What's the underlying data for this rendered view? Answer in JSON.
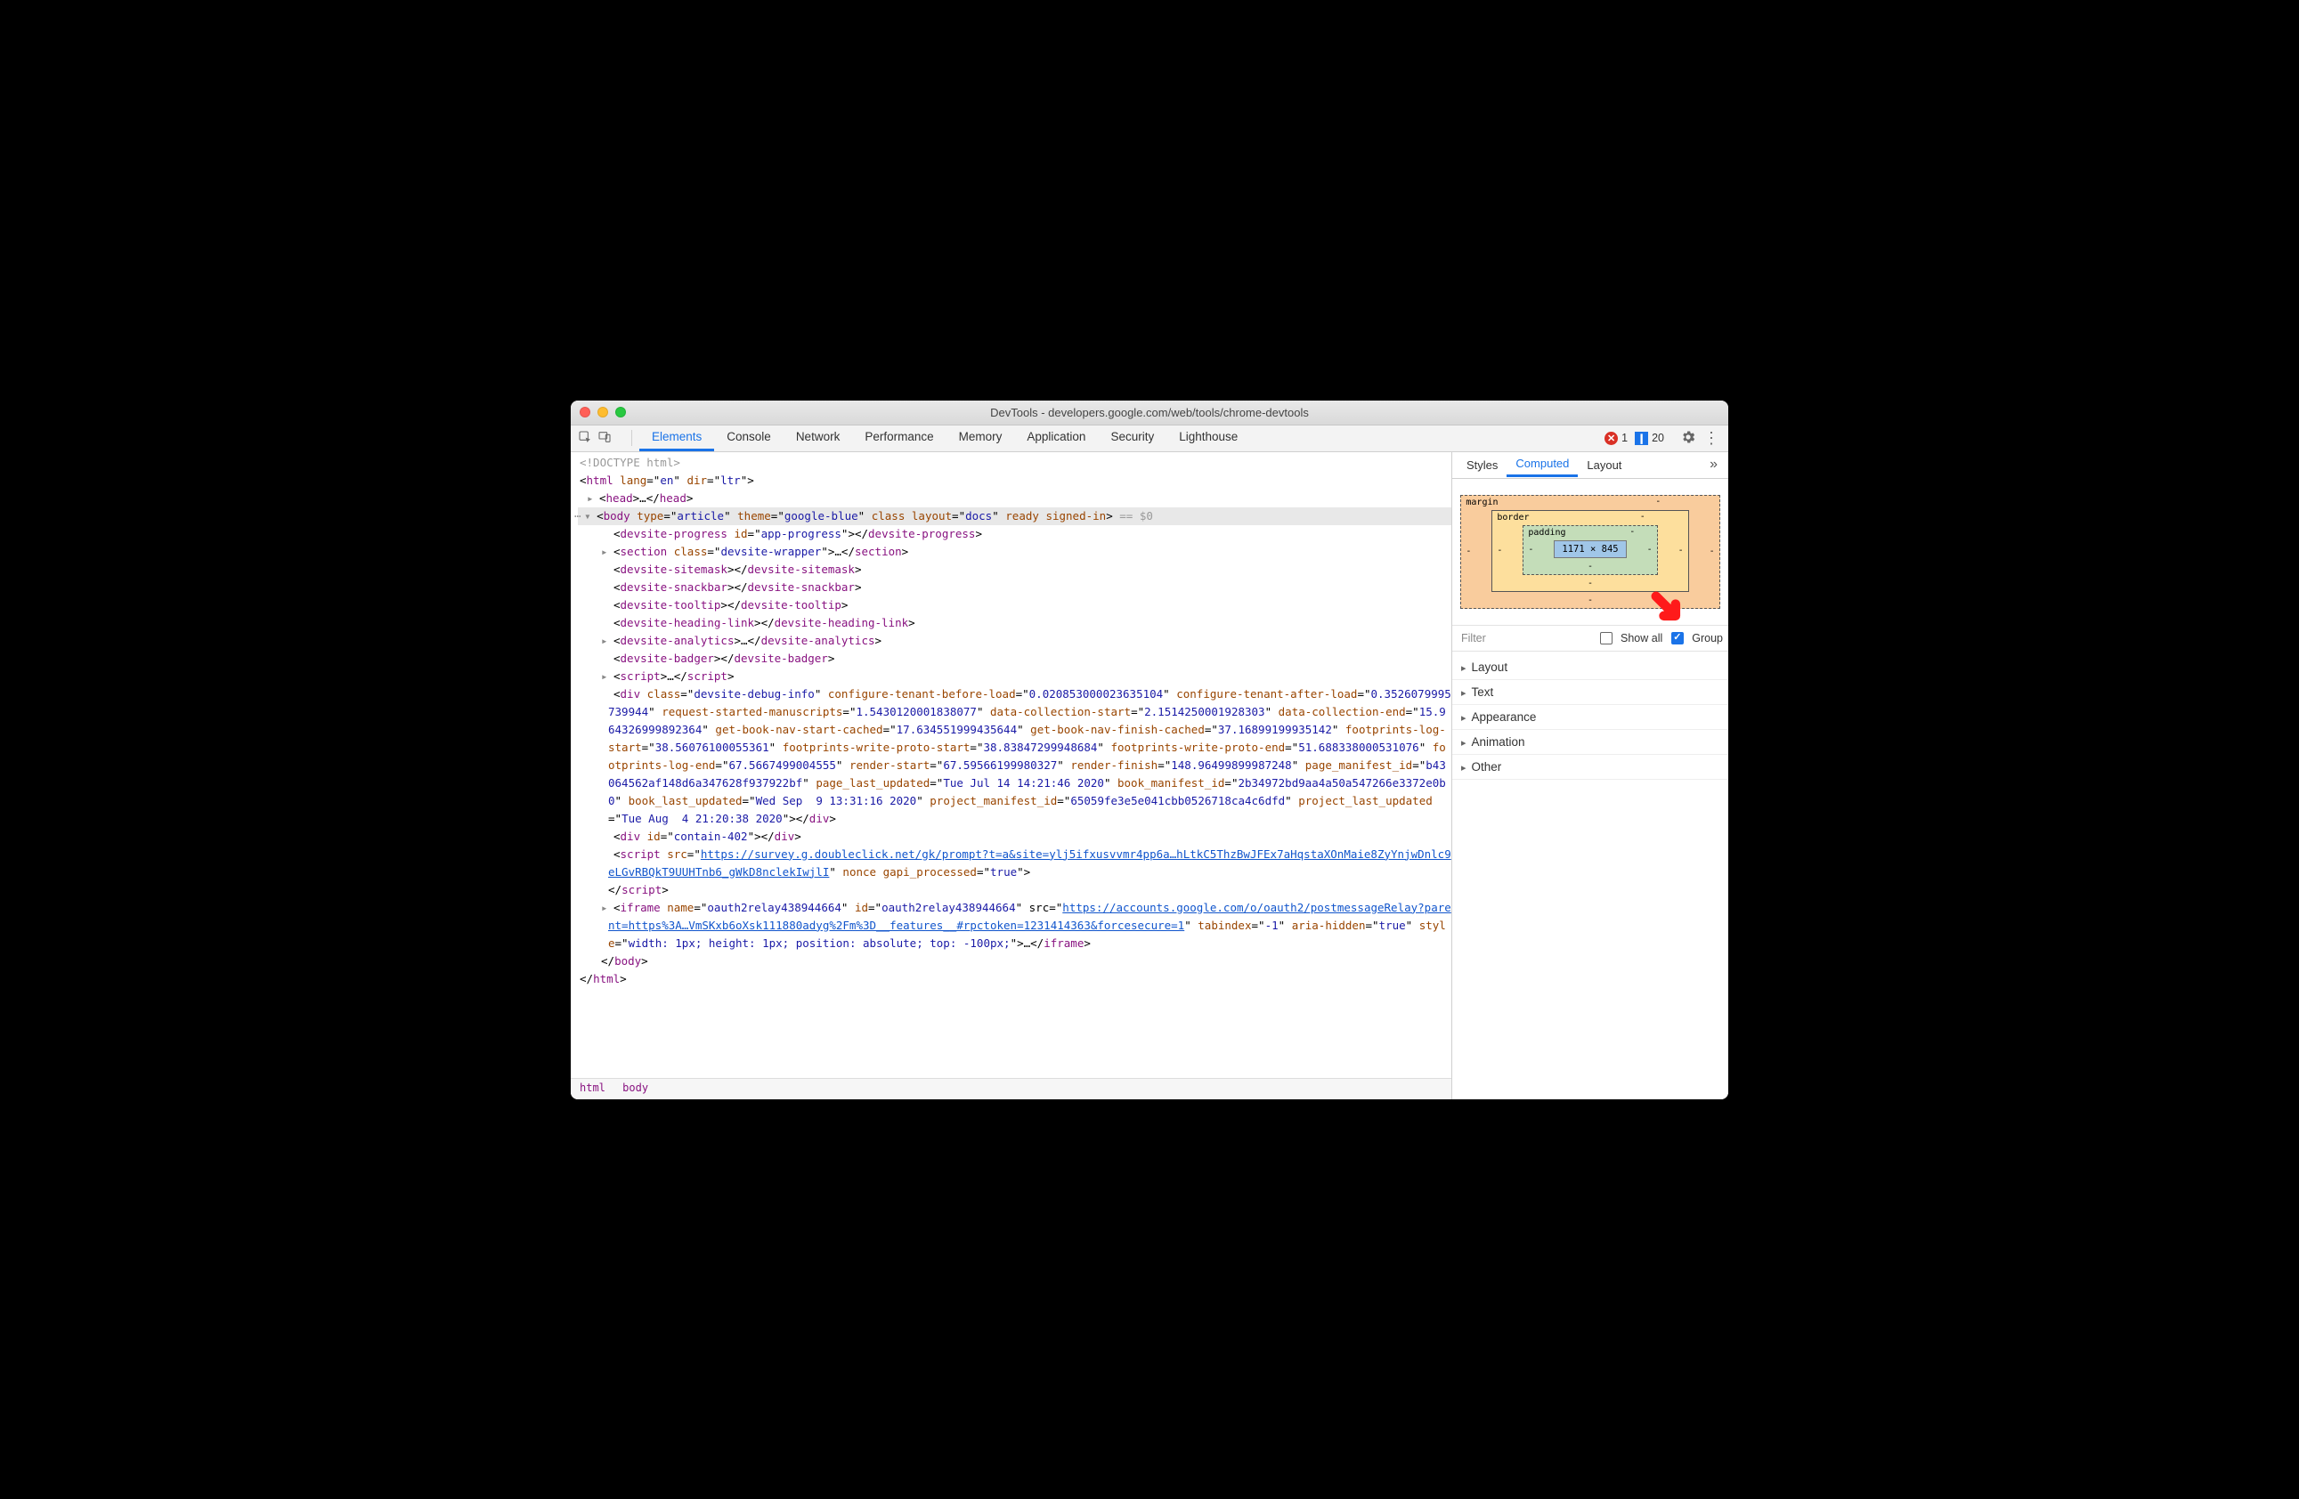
{
  "window": {
    "title": "DevTools - developers.google.com/web/tools/chrome-devtools"
  },
  "colors": {
    "accent": "#1a73e8",
    "error": "#d93025",
    "callout": "#ff1a1a"
  },
  "toolbar": {
    "tabs": [
      "Elements",
      "Console",
      "Network",
      "Performance",
      "Memory",
      "Application",
      "Security",
      "Lighthouse"
    ],
    "active_tab": "Elements",
    "errors_count": "1",
    "messages_count": "20"
  },
  "breadcrumbs": [
    "html",
    "body"
  ],
  "side": {
    "tabs": [
      "Styles",
      "Computed",
      "Layout"
    ],
    "active_tab": "Computed",
    "filter_placeholder": "Filter",
    "show_all_label": "Show all",
    "group_label": "Group",
    "show_all_checked": false,
    "group_checked": true,
    "groups": [
      "Layout",
      "Text",
      "Appearance",
      "Animation",
      "Other"
    ]
  },
  "box_model": {
    "margin": {
      "label": "margin",
      "top": "-",
      "right": "-",
      "bottom": "-",
      "left": "-"
    },
    "border": {
      "label": "border",
      "top": "-",
      "right": "-",
      "bottom": "-",
      "left": "-"
    },
    "padding": {
      "label": "padding",
      "top": "-",
      "right": "-",
      "bottom": "-",
      "left": "-"
    },
    "content": "1171 × 845"
  },
  "dom": {
    "l0": "<!DOCTYPE html>",
    "html_open": {
      "tag": "html",
      "attrs": " lang=\"en\" dir=\"ltr\""
    },
    "head": {
      "tag": "head",
      "ell": "…"
    },
    "body": {
      "tag": "body",
      "attrs": " type=\"article\" theme=\"google-blue\" class layout=\"docs\" ready signed-in",
      "ghost": " == $0"
    },
    "children": [
      {
        "kind": "pair",
        "tag": "devsite-progress",
        "attrs": " id=\"app-progress\""
      },
      {
        "kind": "pair_ell",
        "tag": "section",
        "attrs": " class=\"devsite-wrapper\""
      },
      {
        "kind": "pair",
        "tag": "devsite-sitemask",
        "attrs": ""
      },
      {
        "kind": "pair",
        "tag": "devsite-snackbar",
        "attrs": ""
      },
      {
        "kind": "pair",
        "tag": "devsite-tooltip",
        "attrs": ""
      },
      {
        "kind": "pair",
        "tag": "devsite-heading-link",
        "attrs": ""
      },
      {
        "kind": "pair_ell",
        "tag": "devsite-analytics",
        "attrs": ""
      },
      {
        "kind": "pair",
        "tag": "devsite-badger",
        "attrs": ""
      },
      {
        "kind": "pair_ell",
        "tag": "script",
        "attrs": ""
      }
    ],
    "div_debug": {
      "tag": "div",
      "segments": [
        {
          "a": "class",
          "v": "devsite-debug-info"
        },
        {
          "a": "configure-tenant-before-load",
          "v": "0.020853000023635104"
        },
        {
          "a": "configure-tenant-after-load",
          "v": "0.3526079995739944"
        },
        {
          "a": "request-started-manuscripts",
          "v": "1.5430120001838077"
        },
        {
          "a": "data-collection-start",
          "v": "2.1514250001928303"
        },
        {
          "a": "data-collection-end",
          "v": "15.964326999892364"
        },
        {
          "a": "get-book-nav-start-cached",
          "v": "17.634551999435644"
        },
        {
          "a": "get-book-nav-finish-cached",
          "v": "37.16899199935142"
        },
        {
          "a": "footprints-log-start",
          "v": "38.56076100055361"
        },
        {
          "a": "footprints-write-proto-start",
          "v": "38.83847299948684"
        },
        {
          "a": "footprints-write-proto-end",
          "v": "51.688338000531076"
        },
        {
          "a": "footprints-log-end",
          "v": "67.5667499004555"
        },
        {
          "a": "render-start",
          "v": "67.59566199980327"
        },
        {
          "a": "render-finish",
          "v": "148.96499899987248"
        },
        {
          "a": "page_manifest_id",
          "v": "b43064562af148d6a347628f937922bf"
        },
        {
          "a": "page_last_updated",
          "v": "Tue Jul 14 14:21:46 2020"
        },
        {
          "a": "book_manifest_id",
          "v": "2b34972bd9aa4a50a547266e3372e0b0"
        },
        {
          "a": "book_last_updated",
          "v": "Wed Sep  9 13:31:16 2020"
        },
        {
          "a": "project_manifest_id",
          "v": "65059fe3e5e041cbb0526718ca4c6dfd"
        },
        {
          "a": "project_last_updated",
          "v": "Tue Aug  4 21:20:38 2020"
        }
      ]
    },
    "div_contain": {
      "tag": "div",
      "attrs": " id=\"contain-402\""
    },
    "script_src": {
      "tag": "script",
      "link": "https://survey.g.doubleclick.net/gk/prompt?t=a&site=ylj5ifxusvvmr4pp6a…hLtkC5ThzBwJFEx7aHqstaXOnMaie8ZyYnjwDnlc9eLGvRBQkT9UUHTnb6_gWkD8nclekIwjlI",
      "rest": " nonce gapi_processed=\"true\""
    },
    "iframe": {
      "tag": "iframe",
      "pre": " name=\"oauth2relay438944664\" id=\"oauth2relay438944664\" src=\"",
      "link": "https://accounts.google.com/o/oauth2/postmessageRelay?parent=https%3A…VmSKxb6oXsk111880adyg%2Fm%3D__features__#rpctoken=1231414363&forcesecure=1",
      "post": "\" tabindex=\"-1\" aria-hidden=\"true\" style=\"width: 1px; height: 1px; position: absolute; top: -100px;\""
    }
  }
}
